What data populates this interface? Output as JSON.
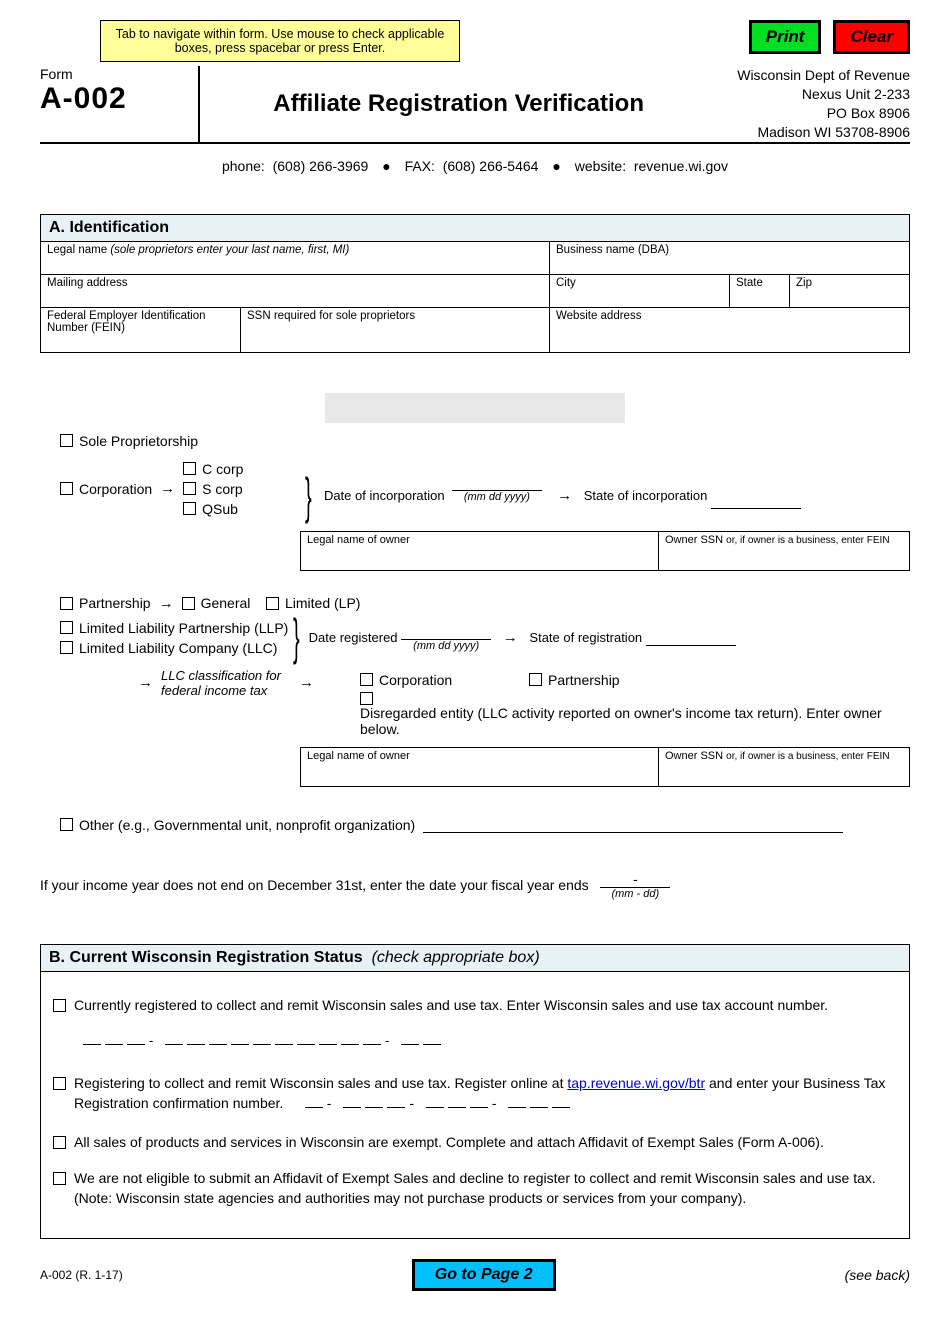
{
  "hint": "Tab to navigate within form. Use mouse to check applicable boxes, press spacebar or press Enter.",
  "buttons": {
    "print": "Print",
    "clear": "Clear",
    "page2": "Go to Page 2"
  },
  "header": {
    "form_label": "Form",
    "form_number": "A-002",
    "title": "Affiliate Registration Verification",
    "dept": {
      "l1": "Wisconsin Dept of Revenue",
      "l2": "Nexus Unit  2-233",
      "l3": "PO Box 8906",
      "l4": "Madison WI  53708-8906"
    }
  },
  "contact": {
    "phone_label": "phone:",
    "phone": "(608) 266-3969",
    "fax_label": "FAX:",
    "fax": "(608) 266-5464",
    "web_label": "website:",
    "web": "revenue.wi.gov"
  },
  "sectionA": {
    "head": "A.  Identification",
    "legal_name": "Legal name",
    "legal_name_hint": "(sole proprietors enter your last name, first, MI)",
    "dba": "Business name (DBA)",
    "mailing": "Mailing address",
    "city": "City",
    "state": "State",
    "zip": "Zip",
    "fein": "Federal Employer Identification Number (FEIN)",
    "ssn": "SSN required for sole proprietors",
    "website": "Website address"
  },
  "entity": {
    "sole": "Sole Proprietorship",
    "corp": "Corporation",
    "ccorp": "C corp",
    "scorp": "S corp",
    "qsub": "QSub",
    "date_inc": "Date of incorporation",
    "date_hint": "(mm dd yyyy)",
    "state_inc": "State of incorporation",
    "owner_legal": "Legal name of owner",
    "owner_ssn": "Owner SSN",
    "owner_ssn_hint": "or, if owner is a business, enter FEIN",
    "partnership": "Partnership",
    "general": "General",
    "limited": "Limited (LP)",
    "llp": "Limited Liability Partnership (LLP)",
    "llc": "Limited Liability Company (LLC)",
    "date_reg": "Date registered",
    "state_reg": "State of registration",
    "llc_class": "LLC classification for federal income tax",
    "class_corp": "Corporation",
    "class_part": "Partnership",
    "class_disr": "Disregarded entity (LLC activity reported on owner's income tax return).  Enter owner below.",
    "other": "Other (e.g., Governmental unit, nonprofit organization)",
    "fiscal": "If your income year does not end on December 31st, enter the date your fiscal year ends",
    "fiscal_val": "-",
    "fiscal_hint": "(mm - dd)"
  },
  "sectionB": {
    "head": "B.  Current Wisconsin Registration Status",
    "head_sub": "(check appropriate box)",
    "opt1": "Currently registered to collect and remit Wisconsin sales and use tax.  Enter Wisconsin sales and use tax account number.",
    "opt2a": "Registering to collect and remit Wisconsin sales and use tax.  Register online at ",
    "opt2_link": "tap.revenue.wi.gov/btr",
    "opt2b": " and enter your Business Tax Registration confirmation number.",
    "opt3": "All sales of products and services in Wisconsin are exempt. Complete and attach Affidavit of Exempt Sales (Form A-006).",
    "opt4": "We are not eligible to submit an Affidavit of Exempt Sales and decline to register to collect and remit Wisconsin sales and use tax.  (Note:  Wisconsin state agencies and authorities may not purchase products or services from your company)."
  },
  "footer": {
    "rev": "A-002 (R. 1-17)",
    "back": "(see back)"
  }
}
